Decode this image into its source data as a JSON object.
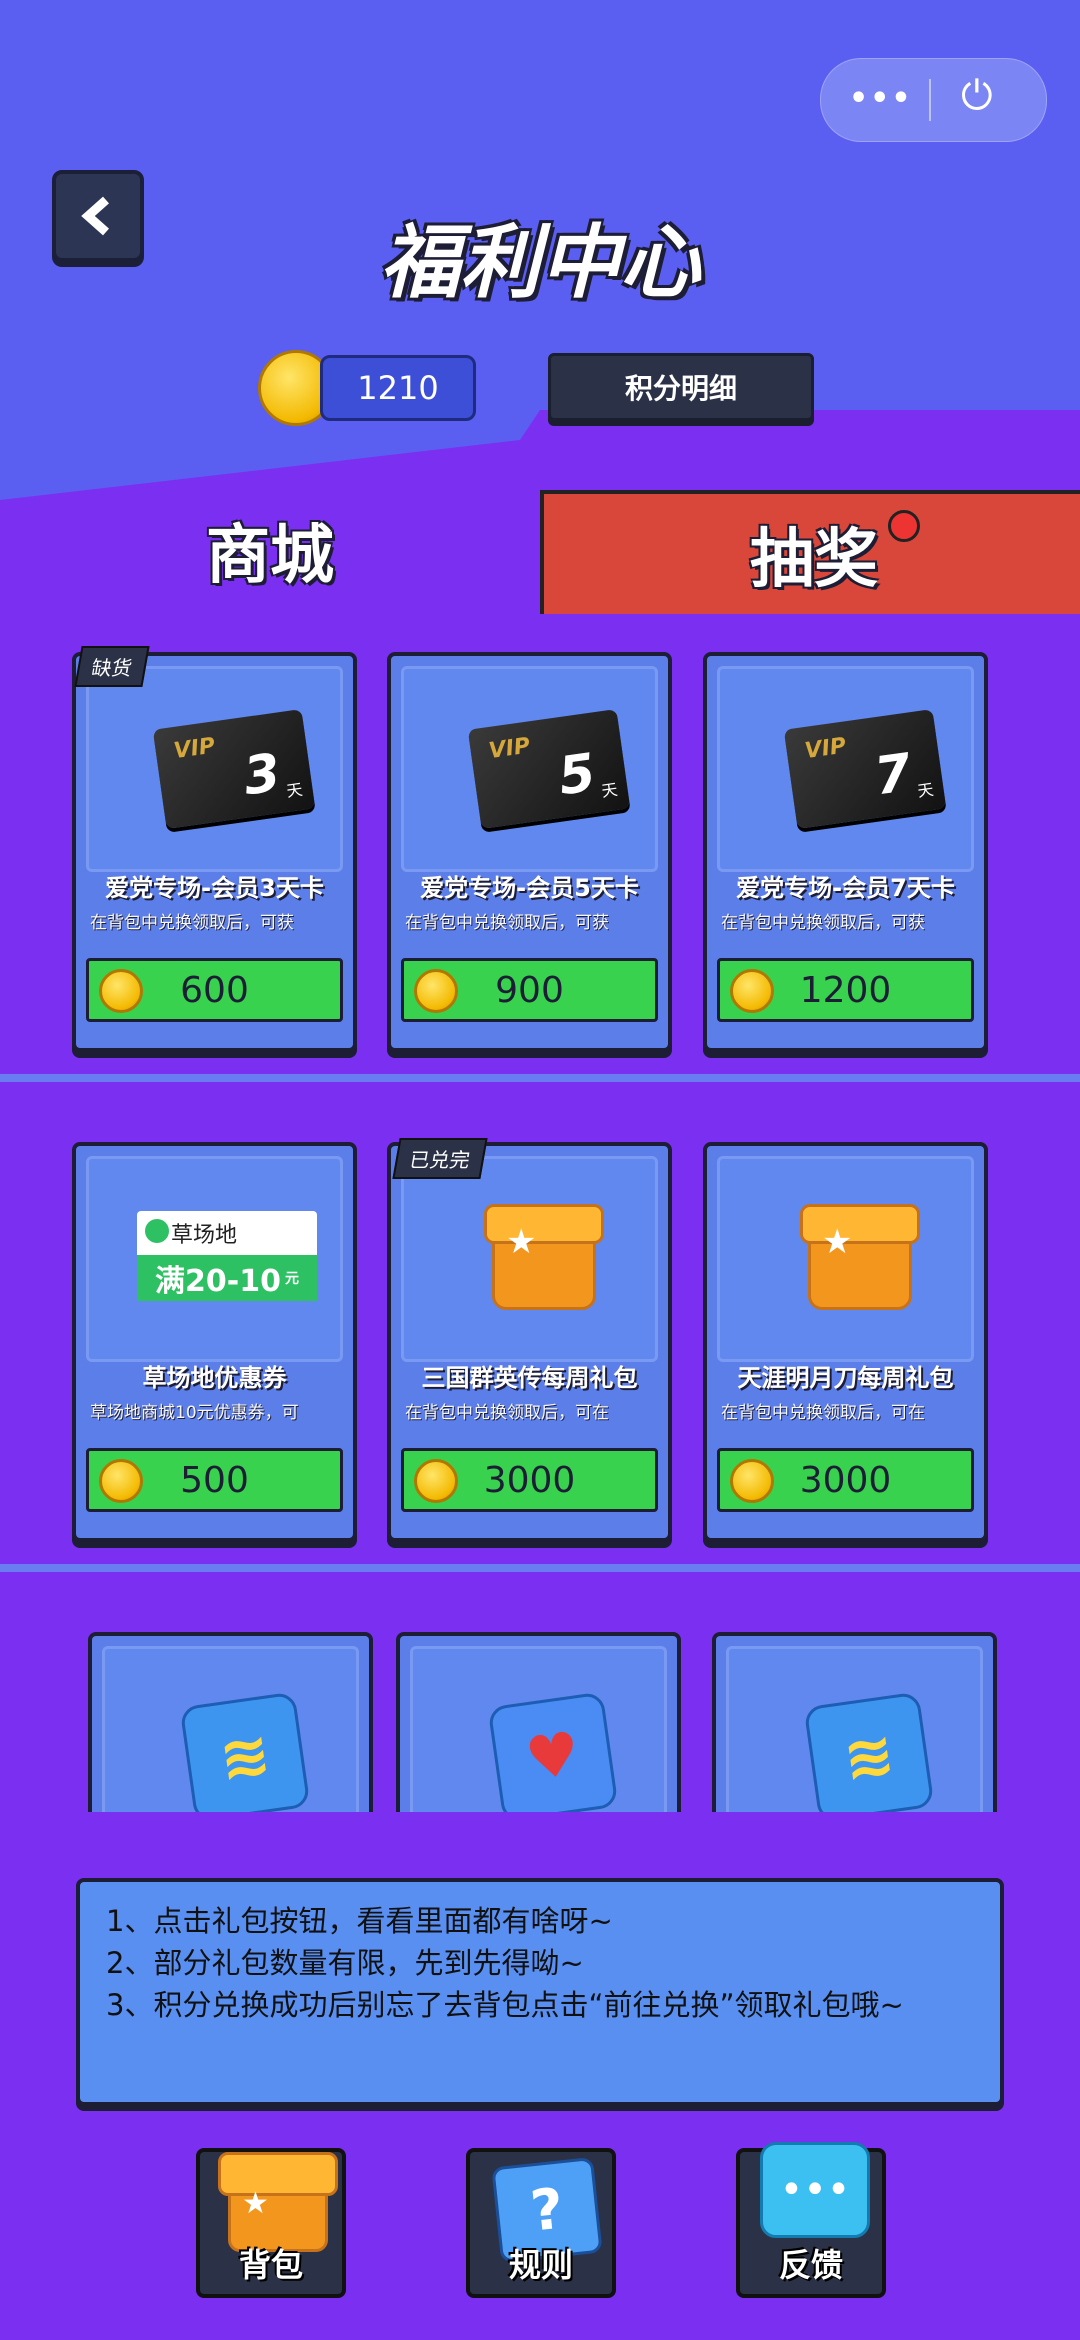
{
  "header": {
    "title": "福利中心",
    "back_icon": "back-arrow-icon",
    "points": "1210",
    "points_detail_label": "积分明细",
    "menu_dots": "•••",
    "power_icon": "⏻"
  },
  "tabs": [
    {
      "label": "商城",
      "active": true
    },
    {
      "label": "抽奖",
      "active": false,
      "has_badge": true
    }
  ],
  "items": [
    {
      "tag": "缺货",
      "vip_days": "3",
      "vip_label": "VIP",
      "day_unit": "天",
      "name": "爱党专场-会员3天卡",
      "desc": "在背包中兑换领取后，可获",
      "price": "600"
    },
    {
      "tag": "",
      "vip_days": "5",
      "vip_label": "VIP",
      "day_unit": "天",
      "name": "爱党专场-会员5天卡",
      "desc": "在背包中兑换领取后，可获",
      "price": "900"
    },
    {
      "tag": "",
      "vip_days": "7",
      "vip_label": "VIP",
      "day_unit": "天",
      "name": "爱党专场-会员7天卡",
      "desc": "在背包中兑换领取后，可获",
      "price": "1200"
    },
    {
      "tag": "",
      "coupon_brand": "草场地",
      "coupon_amount": "满20-10",
      "coupon_unit": "元",
      "name": "草场地优惠券",
      "desc": "草场地商城10元优惠券，可",
      "price": "500"
    },
    {
      "tag": "已兑完",
      "name": "三国群英传每周礼包",
      "desc": "在背包中兑换领取后，可在",
      "price": "3000"
    },
    {
      "tag": "",
      "name": "天涯明月刀每周礼包",
      "desc": "在背包中兑换领取后，可在",
      "price": "3000"
    }
  ],
  "notice": {
    "line1": "1、点击礼包按钮，看看里面都有啥呀~",
    "line2": "2、部分礼包数量有限，先到先得呦~",
    "line3": "3、积分兑换成功后别忘了去背包点击“前往兑换”领取礼包哦~"
  },
  "bottom_nav": [
    {
      "label": "背包",
      "icon": "backpack-box-icon"
    },
    {
      "label": "规则",
      "icon": "rules-question-icon"
    },
    {
      "label": "反馈",
      "icon": "feedback-chat-icon"
    }
  ]
}
